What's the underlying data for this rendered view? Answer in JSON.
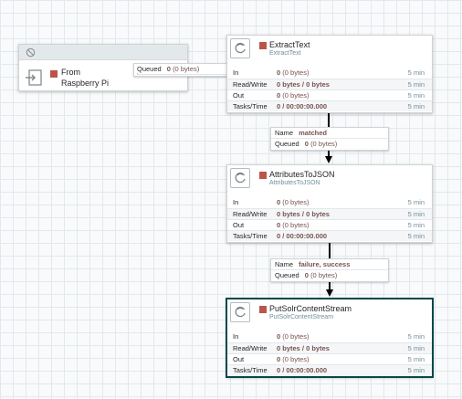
{
  "port": {
    "name_line1": "From",
    "name_line2": "Raspberry Pi",
    "queued_key": "Queued",
    "queued_count": "0",
    "queued_bytes": "(0 bytes)"
  },
  "processors": [
    {
      "name": "ExtractText",
      "type": "ExtractText",
      "stats": {
        "in": {
          "label": "In",
          "count": "0",
          "bytes": "(0 bytes)",
          "time": "5 min"
        },
        "rw": {
          "label": "Read/Write",
          "value": "0 bytes / 0 bytes",
          "time": "5 min"
        },
        "out": {
          "label": "Out",
          "count": "0",
          "bytes": "(0 bytes)",
          "time": "5 min"
        },
        "tasks": {
          "label": "Tasks/Time",
          "value": "0 / 00:00:00.000",
          "time": "5 min"
        }
      }
    },
    {
      "name": "AttributesToJSON",
      "type": "AttributesToJSON",
      "stats": {
        "in": {
          "label": "In",
          "count": "0",
          "bytes": "(0 bytes)",
          "time": "5 min"
        },
        "rw": {
          "label": "Read/Write",
          "value": "0 bytes / 0 bytes",
          "time": "5 min"
        },
        "out": {
          "label": "Out",
          "count": "0",
          "bytes": "(0 bytes)",
          "time": "5 min"
        },
        "tasks": {
          "label": "Tasks/Time",
          "value": "0 / 00:00:00.000",
          "time": "5 min"
        }
      }
    },
    {
      "name": "PutSolrContentStream",
      "type": "PutSolrContentStream",
      "stats": {
        "in": {
          "label": "In",
          "count": "0",
          "bytes": "(0 bytes)",
          "time": "5 min"
        },
        "rw": {
          "label": "Read/Write",
          "value": "0 bytes / 0 bytes",
          "time": "5 min"
        },
        "out": {
          "label": "Out",
          "count": "0",
          "bytes": "(0 bytes)",
          "time": "5 min"
        },
        "tasks": {
          "label": "Tasks/Time",
          "value": "0 / 00:00:00.000",
          "time": "5 min"
        }
      }
    }
  ],
  "connections": [
    {
      "name_key": "Name",
      "name": "matched",
      "queued_key": "Queued",
      "queued_count": "0",
      "queued_bytes": "(0 bytes)"
    },
    {
      "name_key": "Name",
      "name": "failure, success",
      "queued_key": "Queued",
      "queued_count": "0",
      "queued_bytes": "(0 bytes)"
    }
  ],
  "colors": {
    "stopped": "#ba554a",
    "selected_border": "#004849",
    "value_text": "#775351",
    "type_text": "#728e9b"
  }
}
